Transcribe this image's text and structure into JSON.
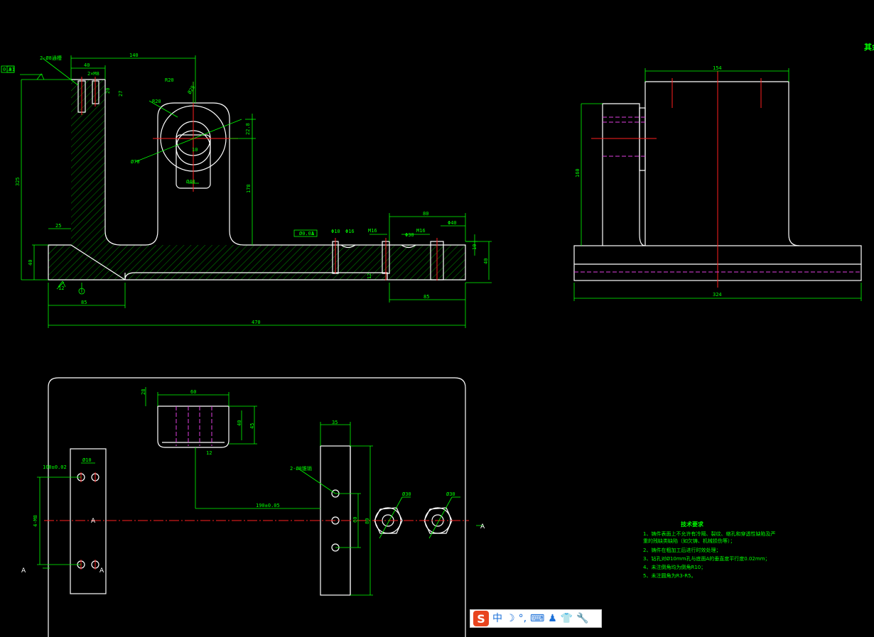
{
  "front_view": {
    "dims": [
      "140",
      "40",
      "2×M8",
      "20",
      "27",
      "R20",
      "R20",
      "Ø25",
      "Ø70",
      "10",
      "22.8",
      "Ø40",
      "325",
      "178",
      "25",
      "40",
      "Φ10",
      "Φ16",
      "M16",
      "M16",
      "Φ30",
      "80",
      "Φ40",
      "Ø0.01",
      "10",
      "12",
      "12",
      "85",
      "470",
      "40",
      "85"
    ],
    "slot_note": "2-Ø8通槽",
    "tol_frame_a": "0.01",
    "tol_frame_b": "A",
    "datum_label": "A"
  },
  "side_view": {
    "dims": [
      "154",
      "160",
      "324"
    ]
  },
  "top_view": {
    "dims": [
      "28",
      "60",
      "45",
      "40",
      "12",
      "35",
      "2-Ø8锥销",
      "Ø10",
      "4-M8",
      "190±0.05",
      "Ø30",
      "Ø30",
      "60",
      "80",
      "100±0.02"
    ],
    "section_marks": [
      "A",
      "A",
      "A",
      "A"
    ]
  },
  "notes": {
    "title": "技术要求",
    "lines": [
      "1、铸件表面上不允许有冷隔、裂纹、缩孔和穿透性缺陷及严",
      "   重的残缺类缺陷（如欠铸、机械损伤等）；",
      "2、铸件在粗加工后进行时效处理；",
      "3、钻孔对Ø10mm孔与底面A的垂直度平行度0.02mm；",
      "4、未注倒角均为倒角R10；",
      "5、未注圆角为R3-R5。"
    ]
  },
  "corner_label": "其余",
  "ime_toolbar": {
    "logo": "S",
    "items": [
      "中",
      "☽",
      "°,",
      "⌨",
      "♟",
      "👕",
      "🔧"
    ]
  }
}
